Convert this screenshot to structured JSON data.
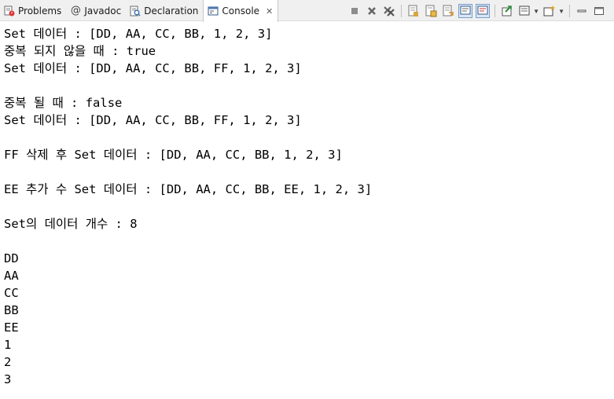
{
  "tabs": [
    {
      "label": "Problems",
      "icon": "problems-icon",
      "active": false
    },
    {
      "label": "Javadoc",
      "icon": "javadoc-icon",
      "active": false
    },
    {
      "label": "Declaration",
      "icon": "declaration-icon",
      "active": false
    },
    {
      "label": "Console",
      "icon": "console-icon",
      "active": true
    }
  ],
  "toolbar": [
    "terminate-icon",
    "remove-launch-icon",
    "remove-all-launches-icon",
    "clear-console-icon",
    "scroll-lock-icon",
    "word-wrap-icon",
    "show-console-on-output-icon",
    "show-console-on-error-icon",
    "pin-console-icon",
    "display-console-icon",
    "new-console-icon",
    "minimize-icon",
    "maximize-icon"
  ],
  "console": {
    "lines": [
      "Set 데이터 : [DD, AA, CC, BB, 1, 2, 3]",
      "중복 되지 않을 때 : true",
      "Set 데이터 : [DD, AA, CC, BB, FF, 1, 2, 3]",
      "",
      "중복 될 때 : false",
      "Set 데이터 : [DD, AA, CC, BB, FF, 1, 2, 3]",
      "",
      "FF 삭제 후 Set 데이터 : [DD, AA, CC, BB, 1, 2, 3]",
      "",
      "EE 추가 수 Set 데이터 : [DD, AA, CC, BB, EE, 1, 2, 3]",
      "",
      "Set의 데이터 개수 : 8",
      "",
      "DD",
      "AA",
      "CC",
      "BB",
      "EE",
      "1",
      "2",
      "3"
    ]
  },
  "colors": {
    "tabbar_bg": "#f0f0f0",
    "console_bg": "#ffffff",
    "text": "#000000"
  }
}
